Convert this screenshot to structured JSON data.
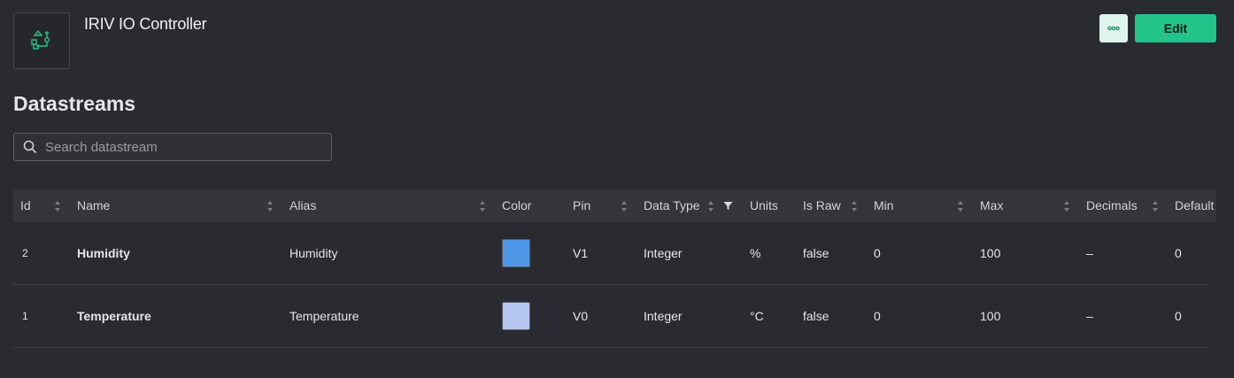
{
  "header": {
    "title": "IRIV IO Controller",
    "more_icon": "ellipsis-icon",
    "edit_label": "Edit",
    "device_icon": "device-template-icon"
  },
  "section": {
    "title": "Datastreams"
  },
  "search": {
    "placeholder": "Search datastream",
    "value": ""
  },
  "colors": {
    "accent": "#23c489",
    "background": "#2a2b30",
    "header_row": "#35363b"
  },
  "table": {
    "columns": [
      "Id",
      "Name",
      "Alias",
      "Color",
      "Pin",
      "Data Type",
      "Units",
      "Is Raw",
      "Min",
      "Max",
      "Decimals",
      "Default"
    ],
    "rows": [
      {
        "id": "2",
        "name": "Humidity",
        "alias": "Humidity",
        "color": "#4d97e6",
        "pin": "V1",
        "data_type": "Integer",
        "units": "%",
        "is_raw": "false",
        "min": "0",
        "max": "100",
        "decimals": "–",
        "default": "0"
      },
      {
        "id": "1",
        "name": "Temperature",
        "alias": "Temperature",
        "color": "#b4c5ef",
        "pin": "V0",
        "data_type": "Integer",
        "units": "°C",
        "is_raw": "false",
        "min": "0",
        "max": "100",
        "decimals": "–",
        "default": "0"
      }
    ]
  }
}
